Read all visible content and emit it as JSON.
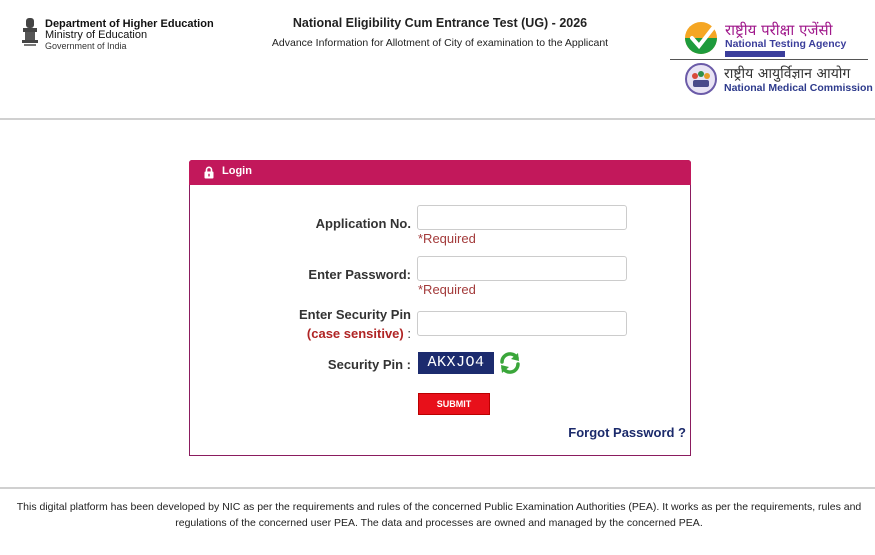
{
  "header": {
    "dept_line1": "Department of Higher Education",
    "dept_line2": "Ministry of Education",
    "dept_line3": "Government of India",
    "title": "National Eligibility Cum Entrance Test (UG) - 2026",
    "subtitle": "Advance Information for Allotment of City of examination to the Applicant",
    "nta_hindi": "राष्ट्रीय परीक्षा एजेंसी",
    "nta_english": "National Testing Agency",
    "nmc_hindi": "राष्ट्रीय आयुर्विज्ञान आयोग",
    "nmc_english": "National Medical Commission",
    "icons": [
      "emblem-icon",
      "nta-logo-icon",
      "nmc-logo-icon"
    ]
  },
  "login": {
    "title": "Login",
    "lock_icon": "lock-icon",
    "application_label": "Application No.",
    "application_value": "",
    "application_placeholder": "",
    "required_text": "*Required",
    "password_label": "Enter Password:",
    "password_value": "",
    "password_placeholder": "",
    "security_pin_label": "Enter Security Pin",
    "case_sensitive": "(case sensitive)",
    "colon": ":",
    "security_pin_value": "",
    "security_pin_display_label": "Security Pin :",
    "captcha": "AKXJO4",
    "refresh_icon": "refresh-icon",
    "submit_label": "SUBMIT",
    "forgot_label": "Forgot Password ?"
  },
  "colors": {
    "login_header": "#c2185b",
    "captcha_bg": "#1c2b6e",
    "submit_bg": "#e8101a",
    "link": "#1b2a6b",
    "required": "#a33a3a"
  },
  "footer": {
    "text": "This digital platform has been developed by NIC as per the requirements and rules of the concerned Public Examination Authorities (PEA). It works as per the requirements, rules and regulations of the concerned user PEA. The data and processes are owned and managed by the concerned PEA."
  }
}
